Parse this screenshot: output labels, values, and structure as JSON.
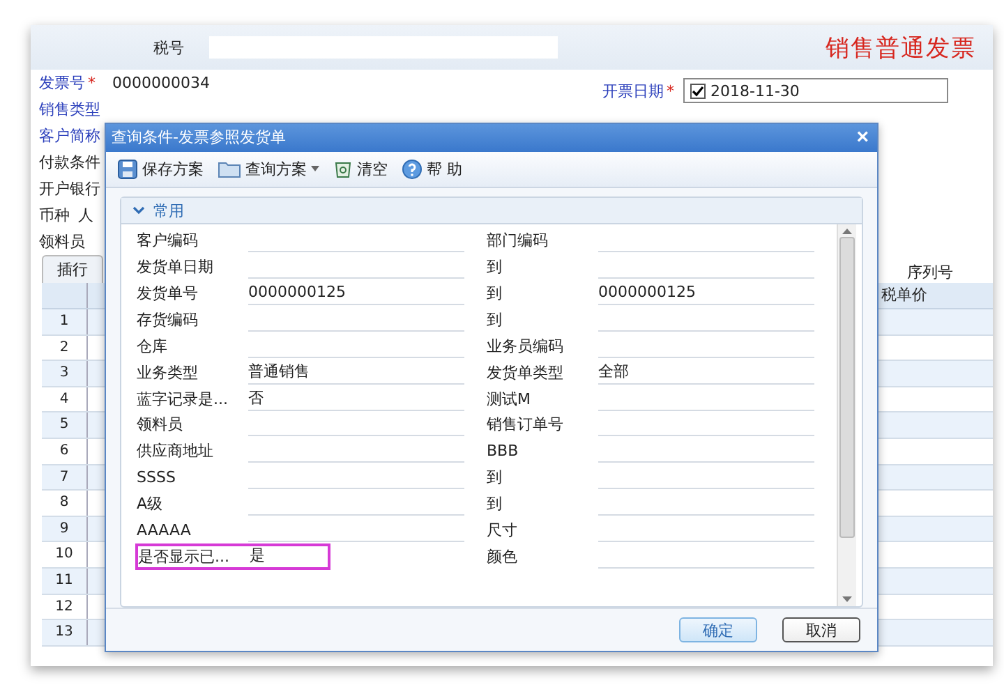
{
  "invoice": {
    "title": "销售普通发票",
    "tax_label": "税号",
    "fields": [
      {
        "label": "发票号",
        "required_mark": "*",
        "value": "0000000034"
      },
      {
        "label": "销售类型"
      },
      {
        "label": "客户简称"
      },
      {
        "label": "付款条件"
      },
      {
        "label": "开户银行"
      },
      {
        "label": "币种",
        "value": "人"
      },
      {
        "label": "领料员"
      }
    ],
    "date": {
      "label": "开票日期",
      "required_mark": "*",
      "checked": true,
      "value": "2018-11-30"
    },
    "table": {
      "tab": "插行",
      "right_header": "序列号",
      "right_column": "税单价",
      "rows": [
        "1",
        "2",
        "3",
        "4",
        "5",
        "6",
        "7",
        "8",
        "9",
        "10",
        "11",
        "12",
        "13"
      ]
    }
  },
  "dialog": {
    "title": "查询条件-发票参照发货单",
    "close": "×",
    "toolbar": [
      {
        "kind": "save",
        "label": "保存方案",
        "dropdown": false
      },
      {
        "kind": "folder",
        "label": "查询方案",
        "dropdown": true
      },
      {
        "kind": "clear",
        "label": "清空",
        "dropdown": false
      },
      {
        "kind": "help",
        "label": "帮 助",
        "dropdown": false
      }
    ],
    "group": {
      "title": "常用",
      "expanded": true,
      "rows": [
        {
          "left": {
            "label": "客户编码"
          },
          "right": {
            "label": "部门编码"
          },
          "highlighted": false
        },
        {
          "left": {
            "label": "发货单日期"
          },
          "right": {
            "label": "到"
          },
          "highlighted": false
        },
        {
          "left": {
            "label": "发货单号",
            "value": "0000000125"
          },
          "right": {
            "label": "到",
            "value": "0000000125"
          },
          "highlighted": false
        },
        {
          "left": {
            "label": "存货编码"
          },
          "right": {
            "label": "到"
          },
          "highlighted": false
        },
        {
          "left": {
            "label": "仓库"
          },
          "right": {
            "label": "业务员编码"
          },
          "highlighted": false
        },
        {
          "left": {
            "label": "业务类型",
            "value": "普通销售"
          },
          "right": {
            "label": "发货单类型",
            "value": "全部"
          },
          "highlighted": false
        },
        {
          "left": {
            "label": "蓝字记录是...",
            "value": "否"
          },
          "right": {
            "label": "测试M"
          },
          "highlighted": false
        },
        {
          "left": {
            "label": "领料员"
          },
          "right": {
            "label": "销售订单号"
          },
          "highlighted": false
        },
        {
          "left": {
            "label": "供应商地址"
          },
          "right": {
            "label": "BBB"
          },
          "highlighted": false
        },
        {
          "left": {
            "label": "SSSS"
          },
          "right": {
            "label": "到"
          },
          "highlighted": false
        },
        {
          "left": {
            "label": "A级"
          },
          "right": {
            "label": "到"
          },
          "highlighted": false
        },
        {
          "left": {
            "label": "AAAAA"
          },
          "right": {
            "label": "尺寸"
          },
          "highlighted": false
        },
        {
          "left": {
            "label": "是否显示已...",
            "value": "是"
          },
          "right": {
            "label": "颜色"
          },
          "highlighted": true
        }
      ]
    },
    "buttons": [
      {
        "label": "确定",
        "kind": "primary"
      },
      {
        "label": "取消",
        "kind": "default"
      }
    ]
  }
}
